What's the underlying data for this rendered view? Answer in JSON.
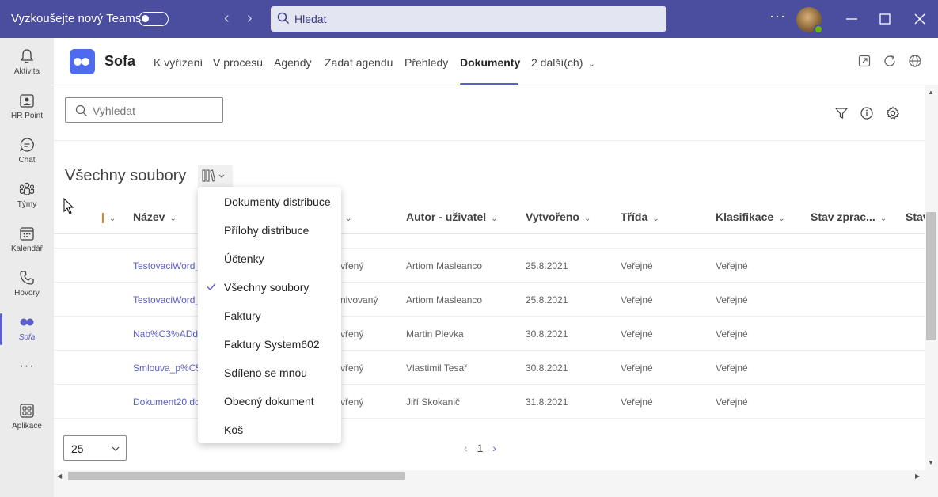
{
  "titlebar": {
    "teams_label": "Vyzkoušejte nový Teams",
    "search_placeholder": "Hledat",
    "more": "···"
  },
  "rail": {
    "items": [
      {
        "label": "Aktivita",
        "icon": "bell-icon"
      },
      {
        "label": "HR Point",
        "icon": "hr-point-icon"
      },
      {
        "label": "Chat",
        "icon": "chat-icon"
      },
      {
        "label": "Týmy",
        "icon": "teams-icon"
      },
      {
        "label": "Kalendář",
        "icon": "calendar-icon"
      },
      {
        "label": "Hovory",
        "icon": "phone-icon"
      },
      {
        "label": "Sofa",
        "icon": "sofa-icon",
        "active": true
      },
      {
        "label": "Aplikace",
        "icon": "apps-icon"
      }
    ],
    "more": "···"
  },
  "app": {
    "name": "Sofa",
    "tabs": [
      "K vyřízení",
      "V procesu",
      "Agendy",
      "Zadat agendu",
      "Přehledy",
      "Dokumenty",
      "2 další(ch)"
    ],
    "active_tab": "Dokumenty"
  },
  "documents": {
    "search_placeholder": "Vyhledat",
    "section_title": "Všechny soubory",
    "columns": [
      "Název",
      "Autor - uživatel",
      "Vytvořeno",
      "Třída",
      "Klasifikace",
      "Stav zprac...",
      "Stav"
    ],
    "rows": [
      {
        "name": "TestovaciWord_",
        "status": "vřený",
        "author": "Artiom Masleanco",
        "created": "25.8.2021",
        "class": "Veřejné",
        "classification": "Veřejné"
      },
      {
        "name": "TestovaciWord_",
        "status": "nivovaný",
        "author": "Artiom Masleanco",
        "created": "25.8.2021",
        "class": "Veřejné",
        "classification": "Veřejné"
      },
      {
        "name": "Nab%C3%ADdk",
        "status": "vřený",
        "author": "Martin Plevka",
        "created": "30.8.2021",
        "class": "Veřejné",
        "classification": "Veřejné"
      },
      {
        "name": "Smlouva_p%C5",
        "status": "vřený",
        "author": "Vlastimil Tesař",
        "created": "30.8.2021",
        "class": "Veřejné",
        "classification": "Veřejné"
      },
      {
        "name": "Dokument20.dc",
        "status": "vřený",
        "author": "Jiří Skokanič",
        "created": "31.8.2021",
        "class": "Veřejné",
        "classification": "Veřejné"
      }
    ],
    "page_size": "25",
    "current_page": "1"
  },
  "view_dropdown": {
    "items": [
      {
        "label": "Dokumenty distribuce",
        "checked": false
      },
      {
        "label": "Přílohy distribuce",
        "checked": false
      },
      {
        "label": "Účtenky",
        "checked": false
      },
      {
        "label": "Všechny soubory",
        "checked": true
      },
      {
        "label": "Faktury",
        "checked": false
      },
      {
        "label": "Faktury System602",
        "checked": false
      },
      {
        "label": "Sdíleno se mnou",
        "checked": false
      },
      {
        "label": "Obecný dokument",
        "checked": false
      },
      {
        "label": "Koš",
        "checked": false
      }
    ]
  },
  "colors": {
    "titlebar": "#4b4e9f",
    "accent": "#5b5fc7",
    "sofa_logo": "#4f6bed",
    "presence": "#6bb700"
  }
}
